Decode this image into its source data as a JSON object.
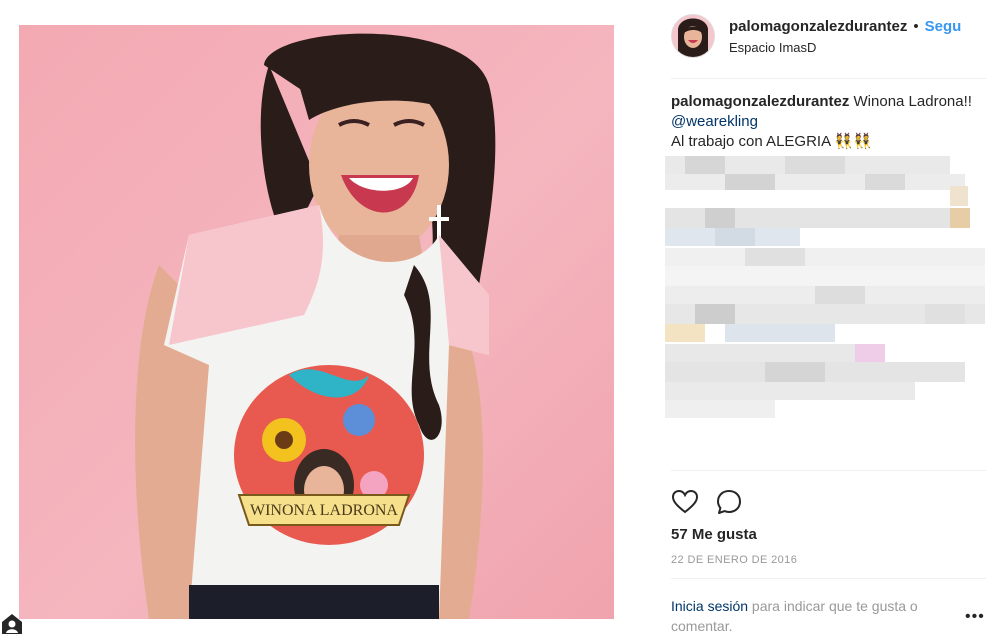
{
  "post": {
    "username": "palomagonzalezdurantez",
    "separator": "•",
    "follow_label": "Segu",
    "location": "Espacio ImasD",
    "caption": {
      "username": "palomagonzalezdurantez",
      "text_part1": " Winona Ladrona!! ",
      "mention": "@wearekling",
      "line2": "Al trabajo con ALEGRIA 👯👯"
    },
    "likes": "57 Me gusta",
    "date": "22 DE ENERO DE 2016",
    "login": {
      "link": "Inicia sesión",
      "text": " para indicar que te gusta o comentar."
    },
    "more": "•••"
  },
  "photo": {
    "shirt_text": "WINONA LADRONA"
  },
  "icons": {
    "heart": "heart-icon",
    "comment": "comment-icon",
    "more": "more-options-icon",
    "corner": "user-tag-icon"
  },
  "colors": {
    "follow": "#3897f0",
    "mention": "#003569",
    "photo_bg": "#f3a9b2"
  }
}
